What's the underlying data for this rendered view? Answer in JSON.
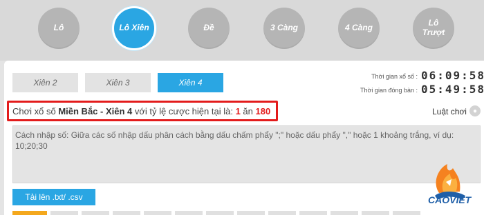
{
  "nav": {
    "items": [
      {
        "label": "Lô",
        "active": false
      },
      {
        "label": "Lô Xiên",
        "active": true
      },
      {
        "label": "Đề",
        "active": false
      },
      {
        "label": "3 Càng",
        "active": false
      },
      {
        "label": "4 Càng",
        "active": false
      },
      {
        "label": "Lô\nTrượt",
        "active": false
      }
    ]
  },
  "tabs": [
    {
      "label": "Xiên 2",
      "active": false
    },
    {
      "label": "Xiên 3",
      "active": false
    },
    {
      "label": "Xiên 4",
      "active": true
    }
  ],
  "timers": {
    "draw_label": "Thời gian xổ số :",
    "draw_value": "06:09:58",
    "close_label": "Thời gian đóng bàn :",
    "close_value": "05:49:58"
  },
  "rate": {
    "prefix": "Chơi xổ số ",
    "game": "Miền Bắc - Xiên 4",
    "middle": " với tỷ lệ cược hiện tại là:  ",
    "stake": "1",
    "sep": " ăn ",
    "payout": "180"
  },
  "rules_link": "Luật chơi",
  "input": {
    "placeholder": "Cách nhập số: Giữa các số nhập dấu phân cách bằng dấu chấm phẩy \";\" hoặc dấu phẩy \",\" hoặc 1 khoảng trắng, ví dụ: 10;20;30"
  },
  "upload_button": "Tải lên .txt/ .csv",
  "logo": {
    "text": "CAOVIET"
  },
  "colors": {
    "accent": "#2aa6e3",
    "highlight": "#e31b1b",
    "nav_inactive": "#b5b5b5"
  }
}
